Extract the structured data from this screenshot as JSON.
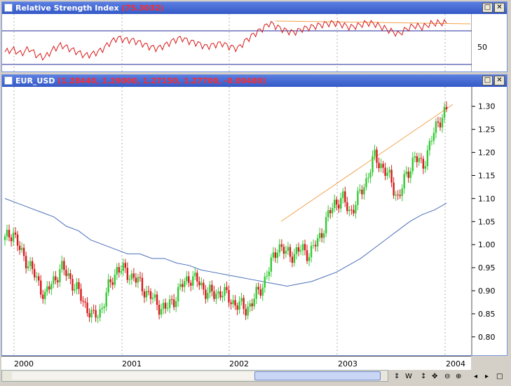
{
  "rsi_window": {
    "title": "Relative Strength Index",
    "value": "(75.3032)",
    "axis_label": "50",
    "buttons": {
      "restore": "□",
      "close": "✕"
    }
  },
  "price_window": {
    "title": "EUR_USD",
    "values": "(1.28440, 1.29000, 1.27150, 1.27700, -0.00480)",
    "buttons": {
      "restore": "□",
      "close": "✕"
    },
    "y_ticks": [
      "1.30",
      "1.25",
      "1.20",
      "1.15",
      "1.10",
      "1.05",
      "1.00",
      "0.95",
      "0.90",
      "0.85",
      "0.80"
    ]
  },
  "x_axis": {
    "labels": [
      "2000",
      "2001",
      "2002",
      "2003",
      "2004"
    ]
  },
  "toolbar": {
    "icons": [
      "updown-arrows-icon",
      "w-label",
      "vertical-move-icon",
      "pan-icon",
      "zoom-out-icon",
      "zoom-in-icon"
    ],
    "w_label": "W"
  },
  "scrollbar": {
    "left_arrow": "◂",
    "right_arrow": "▸",
    "end_box": "□"
  },
  "chart_data": {
    "type": "line",
    "title": "EUR_USD",
    "series": [
      {
        "name": "EUR_USD",
        "values": [
          1.01,
          1.03,
          0.98,
          0.96,
          0.92,
          0.89,
          0.92,
          0.95,
          0.93,
          0.9,
          0.87,
          0.84,
          0.86,
          0.91,
          0.95,
          0.94,
          0.93,
          0.91,
          0.89,
          0.87,
          0.86,
          0.88,
          0.91,
          0.93,
          0.92,
          0.9,
          0.89,
          0.9,
          0.88,
          0.87,
          0.86,
          0.88,
          0.91,
          0.95,
          1.0,
          0.98,
          0.98,
          0.99,
          0.98,
          1.01,
          1.05,
          1.09,
          1.1,
          1.07,
          1.1,
          1.14,
          1.19,
          1.17,
          1.14,
          1.1,
          1.15,
          1.19,
          1.17,
          1.22,
          1.27,
          1.29
        ]
      },
      {
        "name": "",
        "values": [
          1.1,
          1.09,
          1.08,
          1.07,
          1.06,
          1.04,
          1.03,
          1.01,
          1.0,
          0.99,
          0.98,
          0.98,
          0.97,
          0.97,
          0.96,
          0.955,
          0.945,
          0.94,
          0.935,
          0.93,
          0.925,
          0.92,
          0.915,
          0.91,
          0.915,
          0.92,
          0.93,
          0.94,
          0.955,
          0.97,
          0.99,
          1.01,
          1.03,
          1.05,
          1.065,
          1.075,
          1.09
        ]
      }
    ],
    "ylim": [
      0.78,
      1.33
    ],
    "y_ticks": [
      0.8,
      0.85,
      0.9,
      0.95,
      1.0,
      1.05,
      1.1,
      1.15,
      1.2,
      1.25,
      1.3
    ],
    "x_labels": [
      "2000",
      "2001",
      "2002",
      "2003",
      "2004"
    ],
    "rsi": {
      "values": [
        42,
        45,
        40,
        46,
        38,
        36,
        45,
        50,
        46,
        42,
        38,
        40,
        44,
        52,
        58,
        56,
        55,
        52,
        48,
        46,
        50,
        55,
        58,
        54,
        52,
        48,
        50,
        52,
        48,
        46,
        55,
        62,
        68,
        75,
        70,
        66,
        64,
        68,
        70,
        72,
        74,
        75,
        73,
        70,
        72,
        75,
        74,
        70,
        66,
        62,
        68,
        72,
        70,
        74,
        75,
        75
      ],
      "ylim": [
        0,
        100
      ],
      "levels": [
        70,
        30
      ],
      "tick": 50
    }
  }
}
